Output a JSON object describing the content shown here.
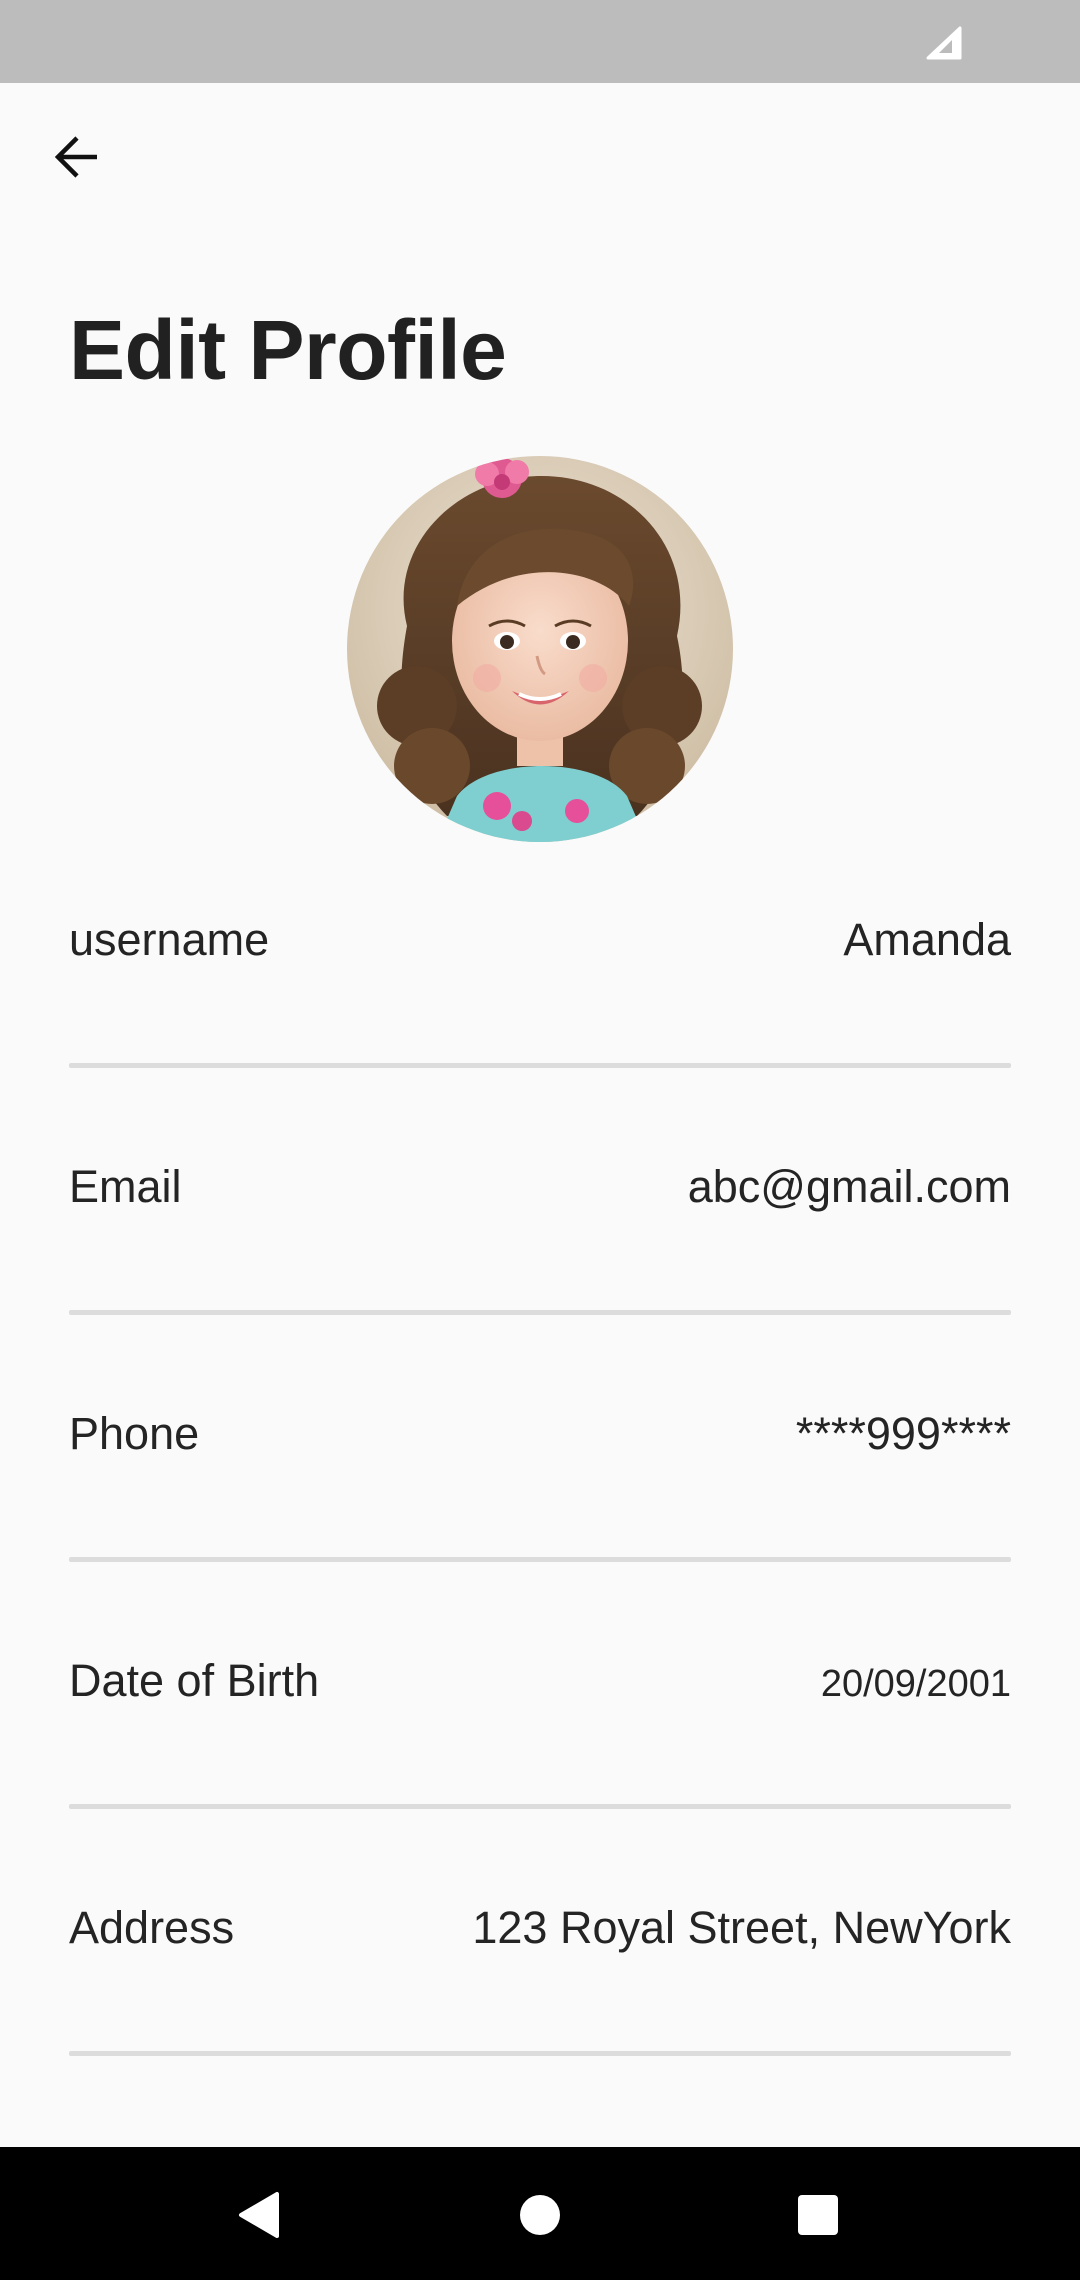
{
  "status_bar": {
    "icons": [
      "signal-icon"
    ]
  },
  "header": {
    "back_icon": "arrow-left-icon",
    "title": "Edit Profile"
  },
  "profile": {
    "avatar_description": "profile-photo"
  },
  "fields": [
    {
      "label": "username",
      "value": "Amanda"
    },
    {
      "label": "Email",
      "value": "abc@gmail.com"
    },
    {
      "label": "Phone",
      "value": "****999****"
    },
    {
      "label": "Date of Birth",
      "value": "20/09/2001"
    },
    {
      "label": "Address",
      "value": "123 Royal Street, NewYork"
    }
  ],
  "nav_bar": {
    "icons": [
      "back-triangle-icon",
      "home-circle-icon",
      "recents-square-icon"
    ]
  },
  "colors": {
    "background": "#fafafa",
    "status_bar": "#bcbcbc",
    "divider": "#dcdcdc",
    "text": "#242424",
    "nav_bar": "#000000"
  }
}
